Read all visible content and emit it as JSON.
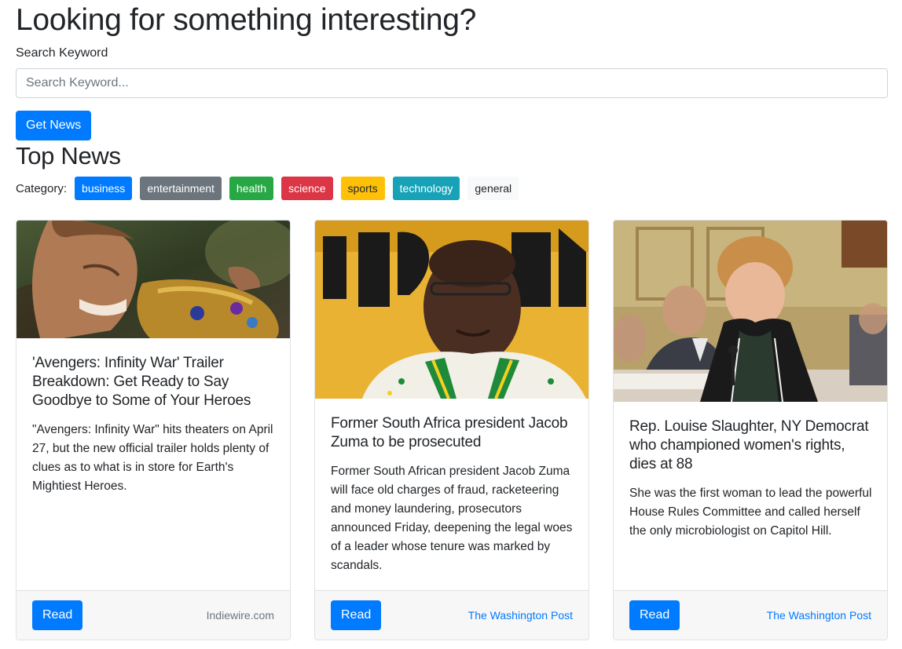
{
  "header": {
    "title": "Looking for something interesting?",
    "search_label": "Search Keyword",
    "search_placeholder": "Search Keyword...",
    "search_value": "",
    "button_label": "Get News"
  },
  "top_news": {
    "title": "Top News",
    "category_label": "Category:",
    "categories": [
      {
        "label": "business",
        "color": "#007bff",
        "text_color": "#ffffff"
      },
      {
        "label": "entertainment",
        "color": "#6c757d",
        "text_color": "#ffffff"
      },
      {
        "label": "health",
        "color": "#28a745",
        "text_color": "#ffffff"
      },
      {
        "label": "science",
        "color": "#dc3545",
        "text_color": "#ffffff"
      },
      {
        "label": "sports",
        "color": "#ffc107",
        "text_color": "#212529"
      },
      {
        "label": "technology",
        "color": "#17a2b8",
        "text_color": "#ffffff"
      },
      {
        "label": "general",
        "color": "#f8f9fa",
        "text_color": "#212529"
      }
    ]
  },
  "articles": [
    {
      "title": "'Avengers: Infinity War' Trailer Breakdown: Get Ready to Say Goodbye to Some of Your Heroes",
      "description": "\"Avengers: Infinity War\" hits theaters on April 27, but the new official trailer holds plenty of clues as to what is in store for Earth's Mightiest Heroes.",
      "read_label": "Read",
      "source": "Indiewire.com",
      "image_icon": "photo-avengers-icon"
    },
    {
      "title": "Former South Africa president Jacob Zuma to be prosecuted",
      "description": "Former South African president Jacob Zuma will face old charges of fraud, racketeering and money laundering, prosecutors announced Friday, deepening the legal woes of a leader whose tenure was marked by scandals.",
      "read_label": "Read",
      "source": "The Washington Post",
      "image_icon": "photo-zuma-icon"
    },
    {
      "title": "Rep. Louise Slaughter, NY Democrat who championed women's rights, dies at 88",
      "description": "She was the first woman to lead the powerful House Rules Committee and called herself the only microbiologist on Capitol Hill.",
      "read_label": "Read",
      "source": "The Washington Post",
      "image_icon": "photo-slaughter-icon"
    }
  ]
}
